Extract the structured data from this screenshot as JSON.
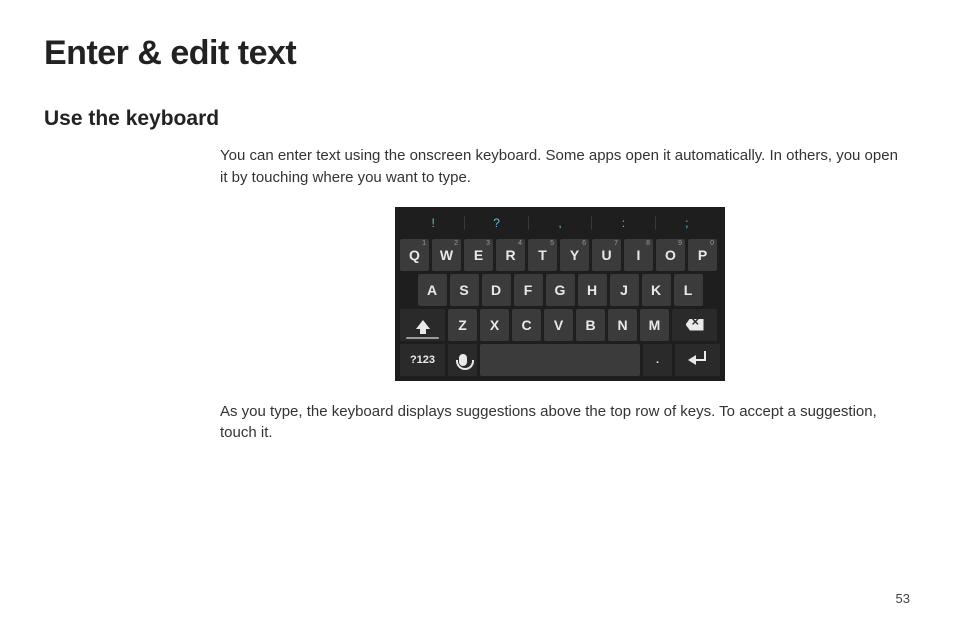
{
  "title": "Enter & edit text",
  "section": "Use the keyboard",
  "para1": "You can enter text using the onscreen keyboard. Some apps open it automatically. In others, you open it by touching where you want to type.",
  "para2": "As you type, the keyboard displays suggestions above the top row of keys. To accept a suggestion, touch it.",
  "page_number": "53",
  "keyboard": {
    "suggestions": [
      "!",
      "?",
      ",",
      ":",
      ";"
    ],
    "row1": [
      {
        "label": "Q",
        "num": "1"
      },
      {
        "label": "W",
        "num": "2"
      },
      {
        "label": "E",
        "num": "3"
      },
      {
        "label": "R",
        "num": "4"
      },
      {
        "label": "T",
        "num": "5"
      },
      {
        "label": "Y",
        "num": "6"
      },
      {
        "label": "U",
        "num": "7"
      },
      {
        "label": "I",
        "num": "8"
      },
      {
        "label": "O",
        "num": "9"
      },
      {
        "label": "P",
        "num": "0"
      }
    ],
    "row2": [
      "A",
      "S",
      "D",
      "F",
      "G",
      "H",
      "J",
      "K",
      "L"
    ],
    "row3": [
      "Z",
      "X",
      "C",
      "V",
      "B",
      "N",
      "M"
    ],
    "fn_label": "?123",
    "period": "."
  }
}
